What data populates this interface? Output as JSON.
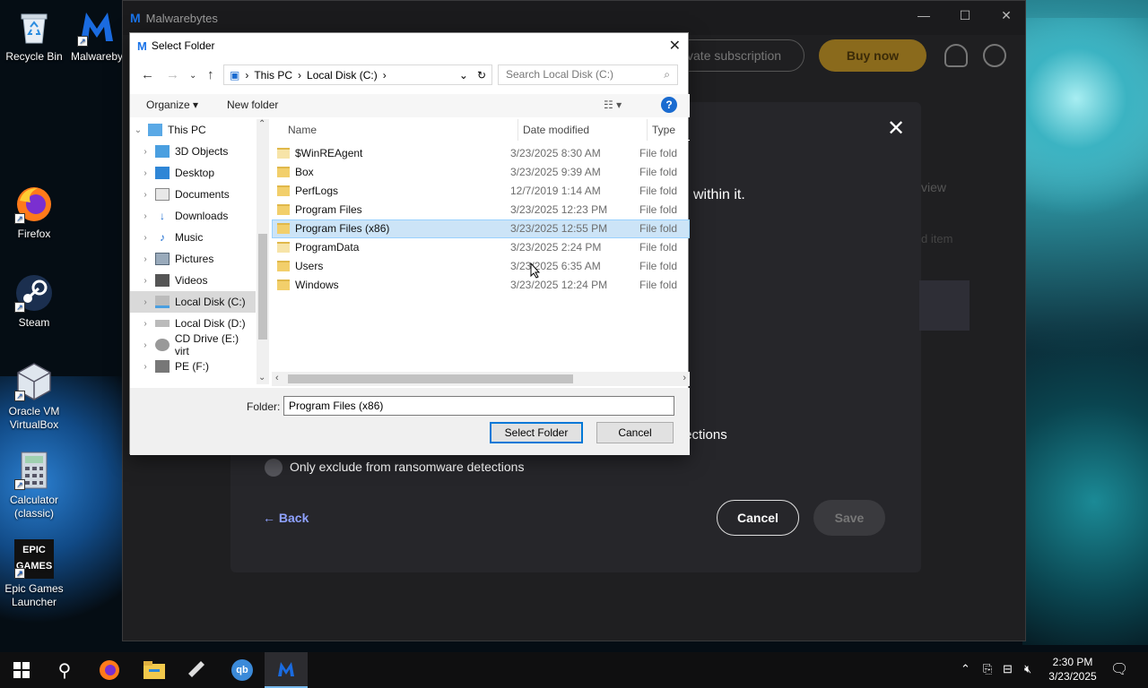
{
  "desktop": {
    "icons": [
      {
        "label": "Recycle Bin"
      },
      {
        "label": "Malwareby"
      },
      {
        "label": "Firefox"
      },
      {
        "label": "Steam"
      },
      {
        "label": "Oracle VM VirtualBox"
      },
      {
        "label": "Calculator (classic)"
      },
      {
        "label": "Epic Games Launcher"
      }
    ],
    "epic_logo_text": "EPIC GAMES"
  },
  "malwarebytes": {
    "title": "Malwarebytes",
    "activate_button": "ivate subscription",
    "buy_button": "Buy now",
    "modal": {
      "text_within": "within it.",
      "text_view": "view",
      "text_add_item": "d item",
      "text_detections": "tections",
      "radio_label": "Only exclude from ransomware detections",
      "back_label": "Back",
      "cancel_label": "Cancel",
      "save_label": "Save"
    }
  },
  "dialog": {
    "title": "Select Folder",
    "address": {
      "parts": [
        "This PC",
        "Local Disk (C:)"
      ]
    },
    "search_placeholder": "Search Local Disk (C:)",
    "toolbar": {
      "organize": "Organize",
      "new_folder": "New folder"
    },
    "tree": [
      {
        "label": "This PC"
      },
      {
        "label": "3D Objects"
      },
      {
        "label": "Desktop"
      },
      {
        "label": "Documents"
      },
      {
        "label": "Downloads"
      },
      {
        "label": "Music"
      },
      {
        "label": "Pictures"
      },
      {
        "label": "Videos"
      },
      {
        "label": "Local Disk (C:)"
      },
      {
        "label": "Local Disk (D:)"
      },
      {
        "label": "CD Drive (E:) virt"
      },
      {
        "label": "PE (F:)"
      }
    ],
    "columns": {
      "name": "Name",
      "date": "Date modified",
      "type": "Type"
    },
    "files": [
      {
        "name": "$WinREAgent",
        "date": "3/23/2025 8:30 AM",
        "type": "File fold"
      },
      {
        "name": "Box",
        "date": "3/23/2025 9:39 AM",
        "type": "File fold"
      },
      {
        "name": "PerfLogs",
        "date": "12/7/2019 1:14 AM",
        "type": "File fold"
      },
      {
        "name": "Program Files",
        "date": "3/23/2025 12:23 PM",
        "type": "File fold"
      },
      {
        "name": "Program Files (x86)",
        "date": "3/23/2025 12:55 PM",
        "type": "File fold"
      },
      {
        "name": "ProgramData",
        "date": "3/23/2025 2:24 PM",
        "type": "File fold"
      },
      {
        "name": "Users",
        "date": "3/23/2025 6:35 AM",
        "type": "File fold"
      },
      {
        "name": "Windows",
        "date": "3/23/2025 12:24 PM",
        "type": "File fold"
      }
    ],
    "folder_label": "Folder:",
    "folder_value": "Program Files (x86)",
    "select_button": "Select Folder",
    "cancel_button": "Cancel"
  },
  "taskbar": {
    "time": "2:30 PM",
    "date": "3/23/2025"
  }
}
